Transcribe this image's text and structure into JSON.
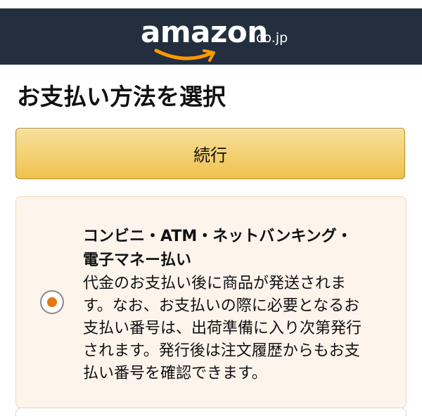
{
  "header": {
    "logo_text": "amazon",
    "logo_tld": ".co.jp",
    "background_color": "#232f3e",
    "smile_color": "#ff9900"
  },
  "page": {
    "title": "お支払い方法を選択"
  },
  "continue_button": {
    "label": "続行"
  },
  "payment_option": {
    "selected": true,
    "title_line1": "コンビニ・ATM・ネットバンキング・",
    "title_line2": "電子マネー払い",
    "description_lines": [
      "代金のお支払い後に商品が発送されま",
      "す。なお、お支払いの際に必要となるお",
      "支払い番号は、出荷準備に入り次第発行",
      "されます。発行後は注文履歴からもお支",
      "払い番号を確認できます。"
    ]
  }
}
